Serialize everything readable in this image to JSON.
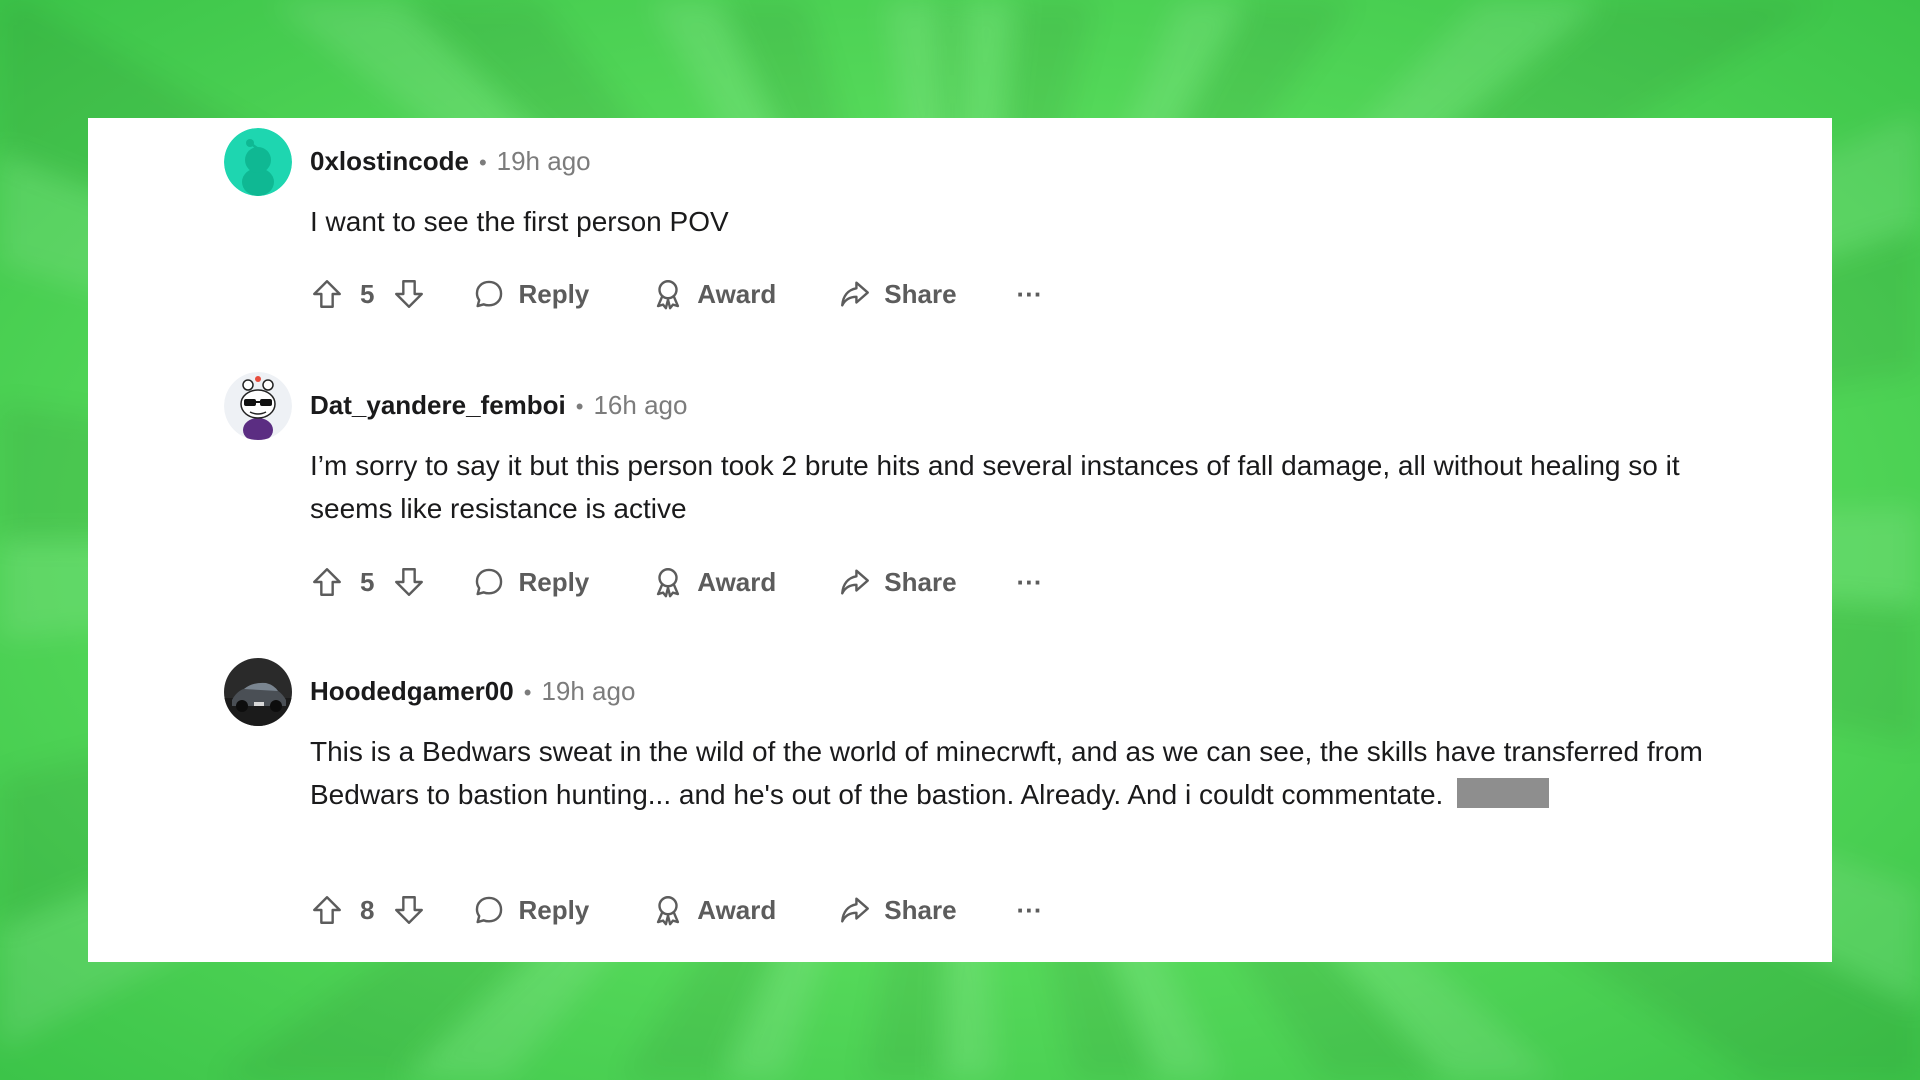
{
  "comments": [
    {
      "username": "0xlostincode",
      "separator": "•",
      "time": "19h ago",
      "body": "I want to see the first person POV",
      "votes": "5",
      "avatar_icon": "snoo-teal-avatar"
    },
    {
      "username": "Dat_yandere_femboi",
      "separator": "•",
      "time": "16h ago",
      "body": "I’m sorry to say it but this person took 2 brute hits and several instances of fall damage, all without healing so it seems like resistance is active",
      "votes": "5",
      "avatar_icon": "snoo-sunglasses-avatar"
    },
    {
      "username": "Hoodedgamer00",
      "separator": "•",
      "time": "19h ago",
      "body": "This is a Bedwars sweat in the wild of the world of minecrwft, and as we can see, the skills have transferred from Bedwars to bastion hunting... and he's out of the bastion. Already. And i couldt commentate.",
      "votes": "8",
      "avatar_icon": "car-photo-avatar"
    }
  ],
  "actions": {
    "reply_label": "Reply",
    "award_label": "Award",
    "share_label": "Share",
    "more_label": "···"
  },
  "colors": {
    "background": "#6ee870",
    "card": "#ffffff",
    "text": "#1a1a1b",
    "muted": "#7c7c7c",
    "action": "#5c5c5c"
  }
}
